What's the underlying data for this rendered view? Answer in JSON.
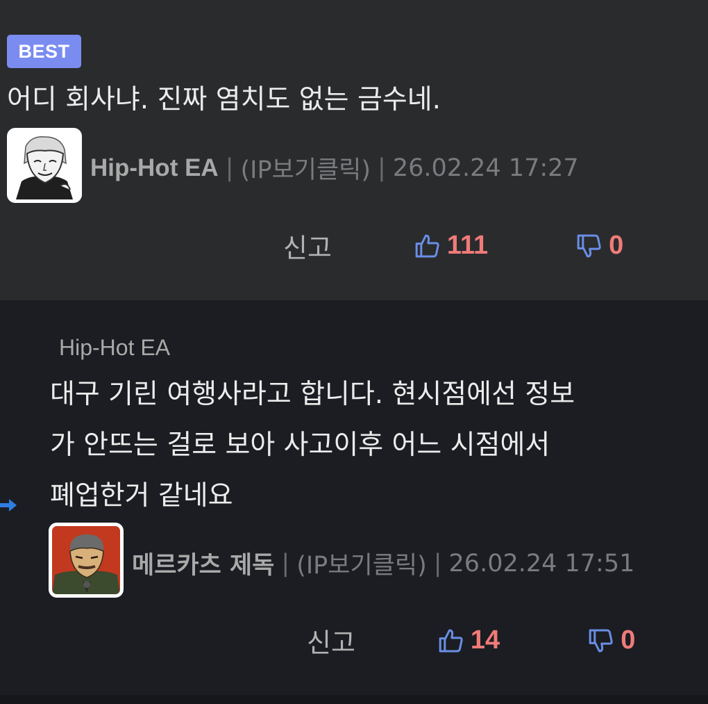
{
  "best_comment": {
    "badge": "BEST",
    "text": "어디 회사냐. 진짜 염치도 없는 금수네.",
    "author": "Hip-Hot EA",
    "ip_link": "(IP보기클릭)",
    "datetime": "26.02.24 17:27",
    "separator": "|",
    "report_label": "신고",
    "likes": "111",
    "dislikes": "0"
  },
  "reply_comment": {
    "reply_to": "Hip-Hot EA",
    "text_lines": [
      "대구 기린 여행사라고 합니다. 현시점에선 정보",
      "가 안뜨는 걸로 보아 사고이후 어느 시점에서",
      "폐업한거 같네요"
    ],
    "author": "메르카츠 제독",
    "ip_link": "(IP보기클릭)",
    "datetime": "26.02.24 17:51",
    "separator": "|",
    "report_label": "신고",
    "likes": "14",
    "dislikes": "0"
  },
  "colors": {
    "best_bg": "#2a2b2d",
    "reply_bg": "#1b1d22",
    "badge_bg": "#7b8cf0",
    "count_color": "#f07b79",
    "icon_color": "#6a8ee6",
    "reply_arrow": "#2f7de1"
  },
  "icons": {
    "like": "thumbs-up-icon",
    "dislike": "thumbs-down-icon",
    "reply_indicator": "reply-arrow-icon"
  }
}
